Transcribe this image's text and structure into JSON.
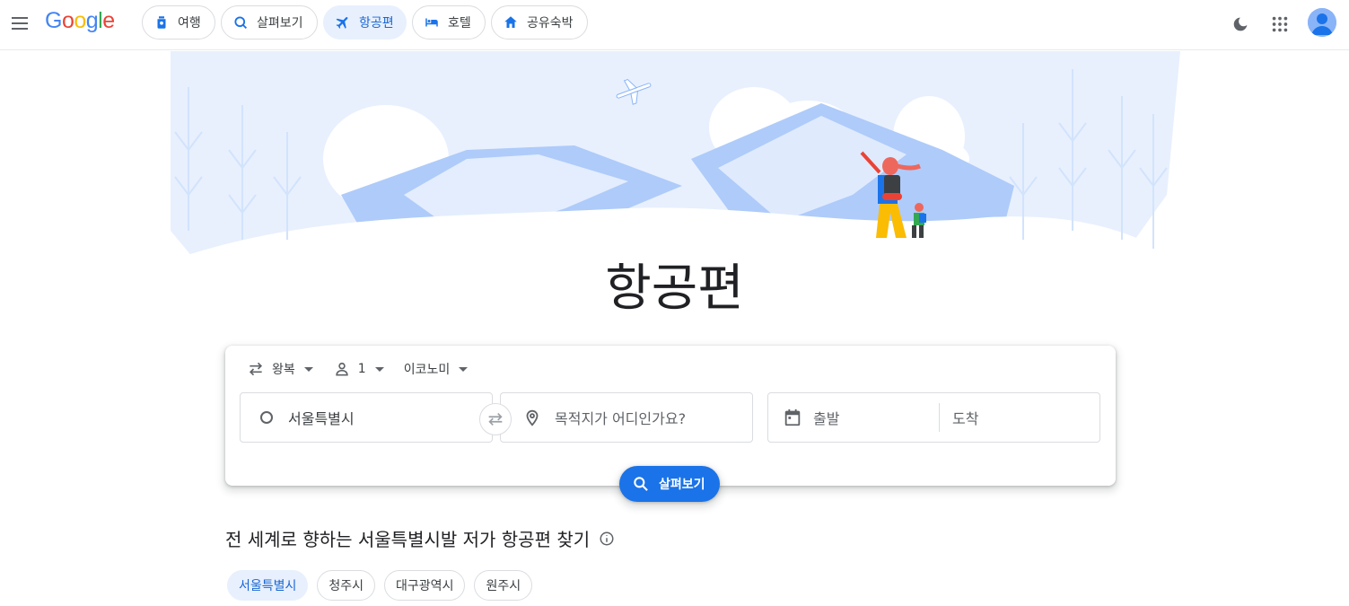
{
  "header": {
    "logo": "Google",
    "logo_letters": [
      {
        "ch": "G",
        "color": "#4285f4"
      },
      {
        "ch": "o",
        "color": "#ea4335"
      },
      {
        "ch": "o",
        "color": "#fbbc05"
      },
      {
        "ch": "g",
        "color": "#4285f4"
      },
      {
        "ch": "l",
        "color": "#34a853"
      },
      {
        "ch": "e",
        "color": "#ea4335"
      }
    ],
    "tabs": [
      {
        "label": "여행",
        "icon": "luggage-tag-icon"
      },
      {
        "label": "살펴보기",
        "icon": "explore-search-icon"
      },
      {
        "label": "항공편",
        "icon": "airplane-icon",
        "active": true
      },
      {
        "label": "호텔",
        "icon": "bed-icon"
      },
      {
        "label": "공유숙박",
        "icon": "home-icon"
      }
    ],
    "icons": [
      "menu-icon",
      "dark-mode-icon",
      "apps-grid-icon",
      "account-avatar-icon"
    ]
  },
  "page": {
    "title": "항공편"
  },
  "search": {
    "trip_type": "왕복",
    "passengers": "1",
    "cabin_class": "이코노미",
    "origin": "서울특별시",
    "destination_placeholder": "목적지가 어디인가요?",
    "departure_placeholder": "출발",
    "return_placeholder": "도착",
    "button_label": "살펴보기"
  },
  "explore": {
    "title": "전 세계로 향하는 서울특별시발 저가 항공편 찾기",
    "cities": [
      {
        "label": "서울특별시",
        "active": true
      },
      {
        "label": "청주시"
      },
      {
        "label": "대구광역시"
      },
      {
        "label": "원주시"
      }
    ]
  },
  "colors": {
    "accent": "#1a73e8",
    "active_chip_bg": "#e8f0fe",
    "active_chip_text": "#1967d2",
    "hero_light": "#e8f0fe",
    "hero_mid": "#aecbfa"
  }
}
